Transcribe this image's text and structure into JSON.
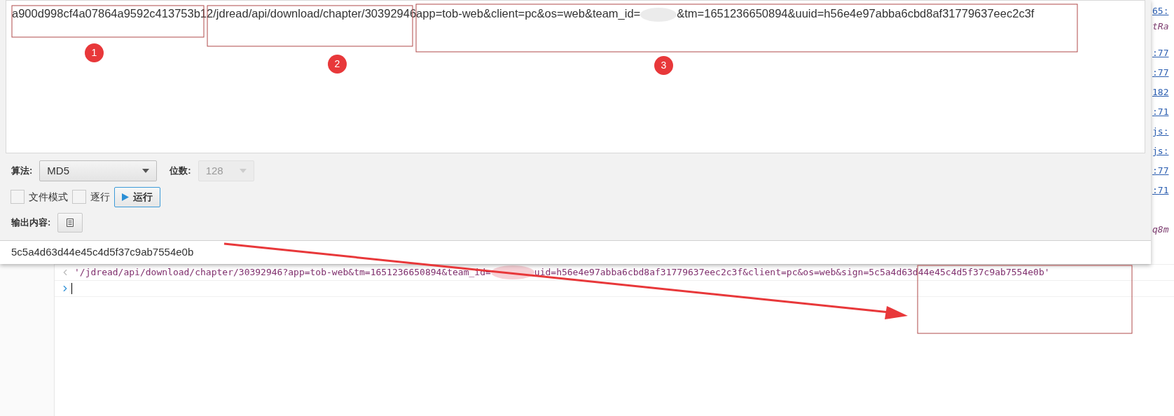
{
  "hash_tool": {
    "input_parts": [
      {
        "kind": "text",
        "text": "a900d998cf4a07864a9592c413753b12"
      },
      {
        "kind": "text",
        "text": "/jdread/api/download/chapter/30392946"
      },
      {
        "kind": "text",
        "text": "app=tob-web&client=pc&os=web&team_id="
      },
      {
        "kind": "redacted"
      },
      {
        "kind": "text",
        "text": "&tm=1651236650894&uuid=h56e4e97abba6cbd8af31779637eec2c3f"
      }
    ],
    "algorithm_label": "算法:",
    "algorithm": "MD5",
    "bits_label": "位数:",
    "bits": "128",
    "bits_disabled": true,
    "options": [
      {
        "label": "文件模式",
        "checked": false
      },
      {
        "label": "逐行",
        "checked": false
      }
    ],
    "run_button": "运行",
    "output_label": "输出内容:",
    "output": "5c5a4d63d44e45c4d5f37c9ab7554e0b"
  },
  "console": {
    "side_items": [
      {
        "kind": "link",
        "text": "65:"
      },
      {
        "kind": "code",
        "text": "tRa"
      },
      {
        "kind": "link",
        "text": ":77"
      },
      {
        "kind": "link",
        "text": ":77"
      },
      {
        "kind": "link",
        "text": "182"
      },
      {
        "kind": "link",
        "text": ":71"
      },
      {
        "kind": "link",
        "text": "js:"
      },
      {
        "kind": "link",
        "text": "js:"
      },
      {
        "kind": "link",
        "text": ":77"
      },
      {
        "kind": "link",
        "text": ":71"
      },
      {
        "kind": "code",
        "text": "q8m"
      }
    ],
    "lines": [
      {
        "kind": "result",
        "parts": [
          {
            "kind": "text",
            "text": "'/jdread/api/download/chapter/30392946?app=tob-web&tm=1651236650894&team_id="
          },
          {
            "kind": "redacted"
          },
          {
            "kind": "text",
            "text": "uid=h56e4e97abba6cbd8af31779637eec2c3f&client=pc&os=web&sign=5c5a4d63d44e45c4d5f37c9ab7554e0b'"
          }
        ]
      },
      {
        "kind": "prompt"
      }
    ]
  },
  "annotations": {
    "markers": [
      "1",
      "2",
      "3"
    ]
  }
}
